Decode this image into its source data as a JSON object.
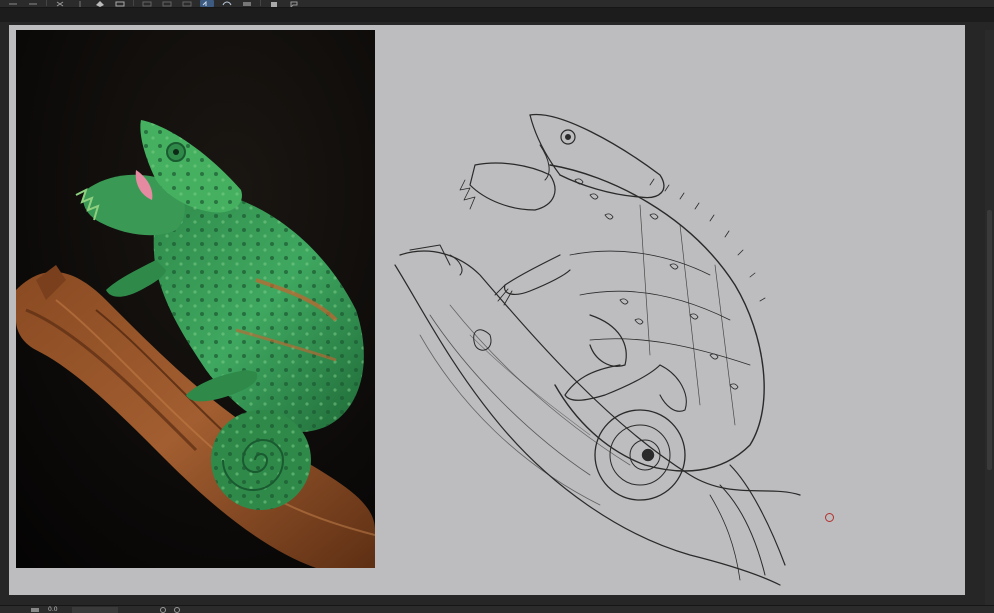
{
  "toolbar": {
    "tools": [
      {
        "name": "undo-icon"
      },
      {
        "name": "redo-icon"
      },
      {
        "name": "transform-icon"
      },
      {
        "name": "symmetry-icon"
      },
      {
        "name": "fill-icon"
      },
      {
        "name": "crop-icon"
      },
      {
        "name": "select-rect-icon"
      },
      {
        "name": "select-ellipse-icon"
      },
      {
        "name": "select-freehand-icon"
      },
      {
        "name": "lasso-icon",
        "active": true
      },
      {
        "name": "eraser-icon"
      },
      {
        "name": "layer-icon"
      },
      {
        "name": "speech-icon"
      }
    ]
  },
  "canvas": {
    "background": "#bdbcbe",
    "reference_photo": {
      "subject": "chameleon-photo"
    },
    "sketch": {
      "subject": "chameleon-sketch"
    }
  },
  "statusbar": {
    "zoom": "0.0"
  },
  "colors": {
    "chrome": "#2b2b2b",
    "canvas": "#bdbcbe",
    "cursor": "#b3302c",
    "active_tool": "#3d5a80"
  }
}
